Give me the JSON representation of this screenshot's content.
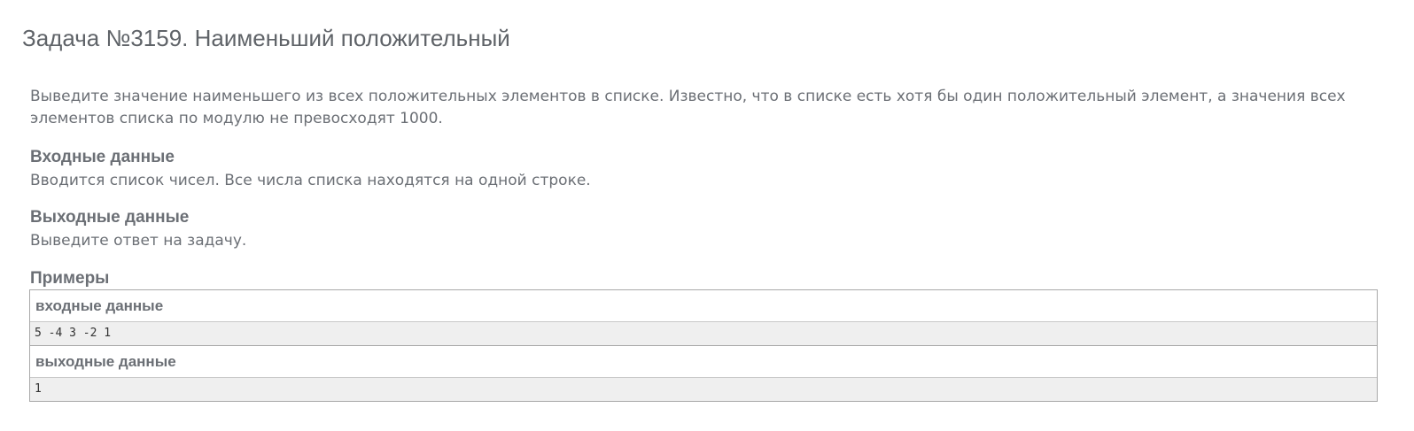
{
  "problem": {
    "title": "Задача №3159. Наименьший положительный",
    "statement": "Выведите значение наименьшего из всех положительных элементов в списке. Известно, что в списке есть хотя бы один положительный элемент, а значения всех элементов списка по модулю не превосходят 1000.",
    "input_heading": "Входные данные",
    "input_text": "Вводится список чисел. Все числа списка находятся на одной строке.",
    "output_heading": "Выходные данные",
    "output_text": "Выведите ответ на задачу.",
    "examples_heading": "Примеры"
  },
  "examples": {
    "input_label": "входные данные",
    "input_value": "5 -4 3 -2 1",
    "output_label": "выходные данные",
    "output_value": "1"
  }
}
